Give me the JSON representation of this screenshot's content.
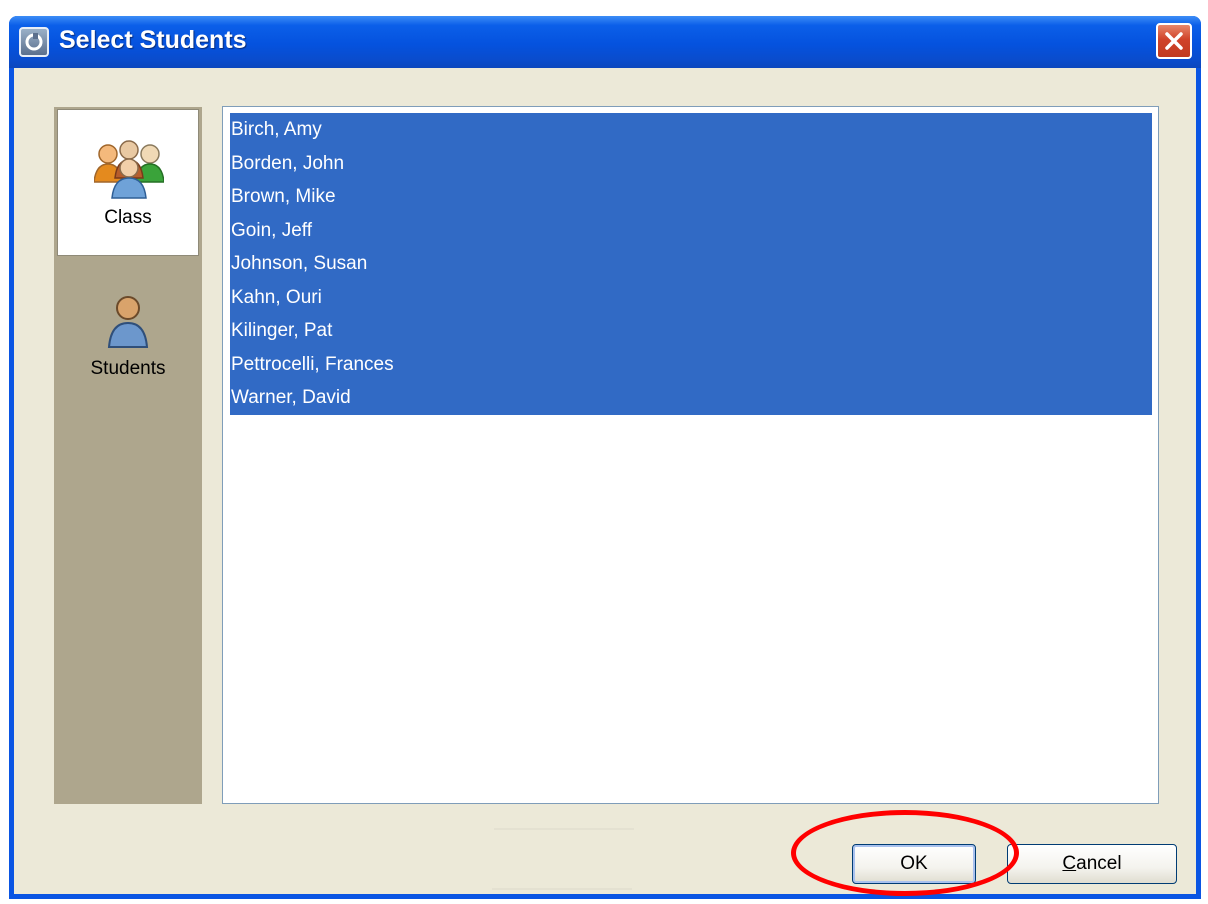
{
  "window": {
    "title": "Select Students"
  },
  "nav": {
    "items": [
      {
        "label": "Class",
        "icon": "group-icon",
        "selected": true
      },
      {
        "label": "Students",
        "icon": "user-icon",
        "selected": false
      }
    ]
  },
  "student_list": {
    "items": [
      "Birch, Amy",
      "Borden, John",
      "Brown, Mike",
      "Goin, Jeff",
      "Johnson, Susan",
      "Kahn, Ouri",
      "Kilinger, Pat",
      "Pettrocelli, Frances",
      "Warner, David"
    ]
  },
  "buttons": {
    "ok_label": "OK",
    "cancel_underlined": "C",
    "cancel_rest": "ancel"
  },
  "colors": {
    "selection": "#316ac5",
    "title_bar": "#0552de",
    "highlight_circle": "#ff0000"
  }
}
